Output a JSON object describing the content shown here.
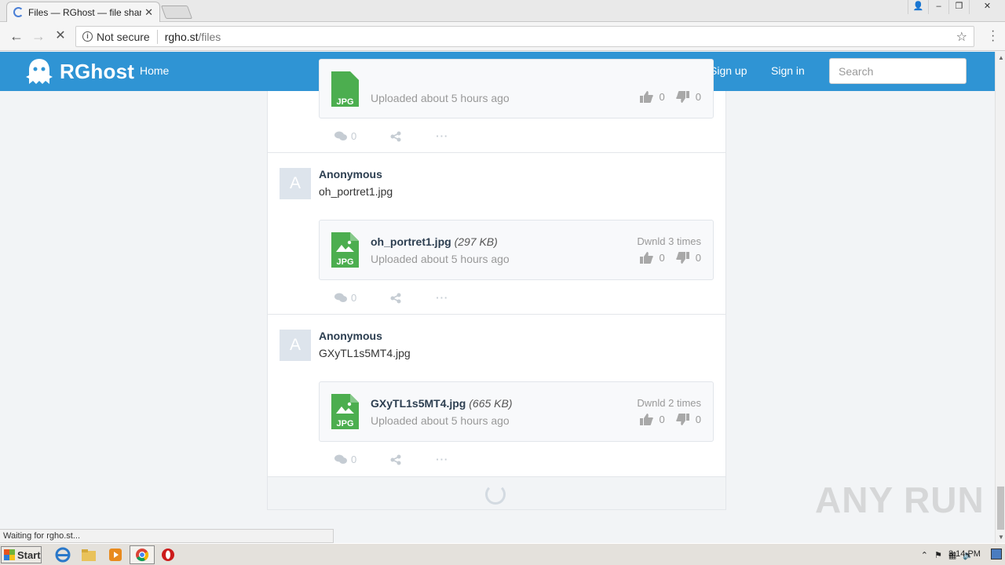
{
  "browser": {
    "tab_title": "Files — RGhost — file sharing",
    "address_security": "Not secure",
    "url_host": "rgho.st",
    "url_path": "/files",
    "status_text": "Waiting for rgho.st..."
  },
  "header": {
    "brand": "RGhost",
    "home": "Home",
    "sign_up": "Sign up",
    "sign_in": "Sign in",
    "search_placeholder": "Search",
    "color": "#2f94d4"
  },
  "partial_post": {
    "uploaded": "Uploaded about 5 hours ago",
    "likes": "0",
    "dislikes": "0",
    "comments": "0"
  },
  "posts": [
    {
      "author": "Anonymous",
      "avatar_letter": "A",
      "description": "oh_portret1.jpg",
      "file_name": "oh_portret1.jpg",
      "file_size": "(297 KB)",
      "uploaded": "Uploaded about 5 hours ago",
      "downloads": "Dwnld 3 times",
      "likes": "0",
      "dislikes": "0",
      "comments": "0"
    },
    {
      "author": "Anonymous",
      "avatar_letter": "A",
      "description": "GXyTL1s5MT4.jpg",
      "file_name": "GXyTL1s5MT4.jpg",
      "file_size": "(665 KB)",
      "uploaded": "Uploaded about 5 hours ago",
      "downloads": "Dwnld 2 times",
      "likes": "0",
      "dislikes": "0",
      "comments": "0"
    }
  ],
  "file_badge": "JPG",
  "watermark": "ANY RUN",
  "taskbar": {
    "start": "Start",
    "clock": "3:14 PM"
  }
}
